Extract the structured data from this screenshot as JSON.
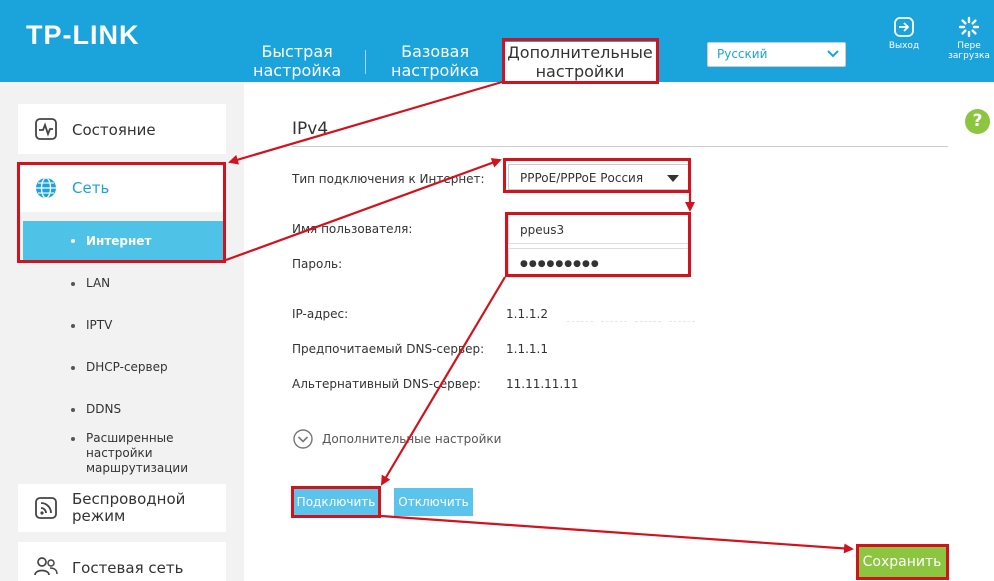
{
  "header": {
    "logo": "TP-LINK",
    "tabs": [
      {
        "line1": "Быстрая",
        "line2": "настройка"
      },
      {
        "line1": "Базовая",
        "line2": "настройка"
      },
      {
        "line1": "Дополнительные",
        "line2": "настройки"
      }
    ],
    "language": "Русский",
    "logout_label": "Выход",
    "reboot_label_line1": "Пере",
    "reboot_label_line2": "загрузка"
  },
  "help_label": "?",
  "sidebar": {
    "items": [
      {
        "label": "Состояние",
        "icon": "status-pulse-icon"
      },
      {
        "label": "Сеть",
        "icon": "globe-icon"
      },
      {
        "label_line1": "Беспроводной",
        "label_line2": "режим",
        "icon": "wifi-icon"
      },
      {
        "label": "Гостевая сеть",
        "icon": "guest-users-icon"
      }
    ],
    "subitems": [
      {
        "label": "Интернет"
      },
      {
        "label": "LAN"
      },
      {
        "label": "IPTV"
      },
      {
        "label": "DHCP-сервер"
      },
      {
        "label": "DDNS"
      },
      {
        "label_line1": "Расширенные",
        "label_line2": "настройки",
        "label_line3": "маршрутизации"
      }
    ]
  },
  "main": {
    "title": "IPv4",
    "connection_type_label": "Тип подключения к Интернет:",
    "connection_type_value": "PPPoE/PPPoE Россия",
    "username_label": "Имя пользователя:",
    "username_value": "ppeus3",
    "password_label": "Пароль:",
    "password_value": "●●●●●●●●●",
    "ip_label": "IP-адрес:",
    "ip_value": "1.1.1.2",
    "dns1_label": "Предпочитаемый DNS-сервер:",
    "dns1_value": "1.1.1.1",
    "dns2_label": "Альтернативный DNS-сервер:",
    "dns2_value": "11.11.11.11",
    "advanced_label": "Дополнительные настройки",
    "connect_label": "Подключить",
    "disconnect_label": "Отключить",
    "save_label": "Сохранить"
  },
  "colors": {
    "header_blue": "#1ba3dc",
    "sidebar_active": "#4fc3e7",
    "button_blue": "#5bc4ec",
    "save_green": "#8cc540",
    "annotation_red": "#d2121d"
  }
}
